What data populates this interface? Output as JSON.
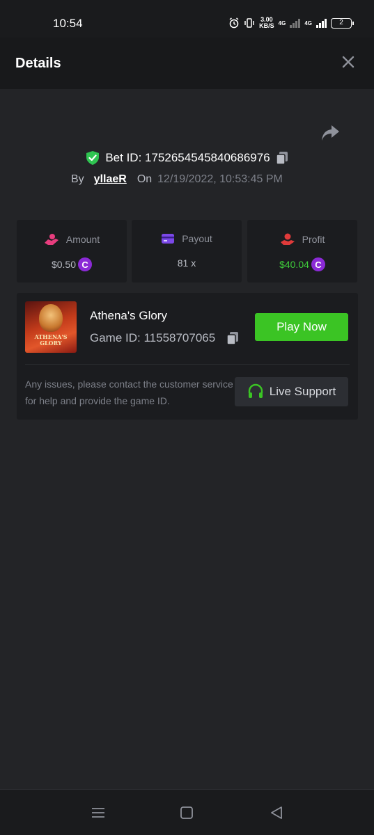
{
  "status_bar": {
    "time": "10:54",
    "net_speed_value": "3.00",
    "net_speed_unit": "KB/S",
    "net_type_1": "4G",
    "net_type_2": "4G",
    "battery": "2",
    "icons": [
      "alarm-icon",
      "vibrate-icon",
      "signal-icon",
      "signal-icon",
      "battery-icon"
    ]
  },
  "header": {
    "title": "Details",
    "close_icon": "close-icon"
  },
  "bet": {
    "label": "Bet ID: 1752654545840686976",
    "by_label": "By",
    "username": "yllaeR",
    "on_label": "On",
    "date": "12/19/2022, 10:53:45 PM",
    "verified_icon": "shield-check-icon",
    "share_icon": "share-icon",
    "copy_icon": "copy-icon"
  },
  "stats": {
    "amount": {
      "label": "Amount",
      "value": "$0.50",
      "icon": "hand-coins-icon",
      "coin_icon": "coin-icon",
      "coin_symbol": "C"
    },
    "payout": {
      "label": "Payout",
      "value": "81 x",
      "icon": "card-icon"
    },
    "profit": {
      "label": "Profit",
      "value": "$40.04",
      "icon": "money-hand-icon",
      "coin_icon": "coin-icon",
      "coin_symbol": "C"
    }
  },
  "game": {
    "name": "Athena's Glory",
    "id_label": "Game ID: 11558707065",
    "thumb_title": "ATHENA'S GLORY",
    "play_label": "Play Now",
    "issue_text": "Any issues, please contact the customer service for help and provide the game ID.",
    "support_label": "Live Support",
    "support_icon": "headset-icon"
  },
  "nav": {
    "icons": [
      "menu-icon",
      "home-icon",
      "back-icon"
    ]
  },
  "colors": {
    "background": "#232427",
    "header": "#18191b",
    "card": "#1b1c1f",
    "accent_green": "#3bc424",
    "profit_green": "#3fcd3b",
    "coin_purple": "#8b2ad6",
    "amount_pink": "#e83d7e",
    "payout_purple": "#7b48e8",
    "profit_red": "#e03a3a"
  }
}
